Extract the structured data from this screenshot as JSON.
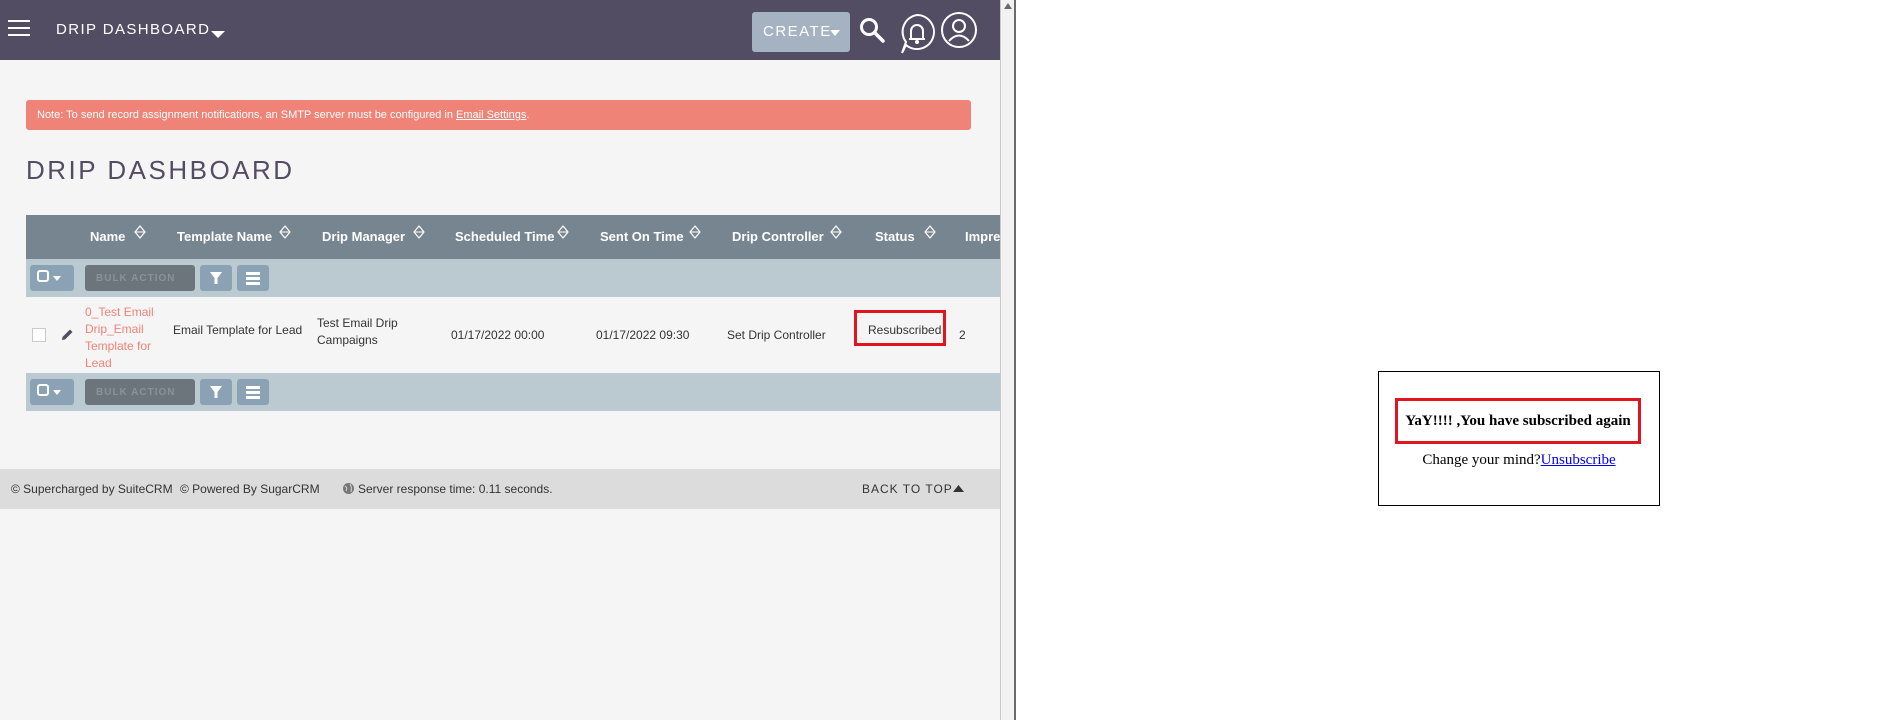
{
  "topbar": {
    "module_title": "DRIP DASHBOARD",
    "create_label": "CREATE"
  },
  "alert": {
    "text": "Note: To send record assignment notifications, an SMTP server must be configured in ",
    "link": "Email Settings",
    "suffix": "."
  },
  "page": {
    "title": "DRIP DASHBOARD"
  },
  "table": {
    "columns": [
      "Name",
      "Template Name",
      "Drip Manager",
      "Scheduled Time",
      "Sent On Time",
      "Drip Controller",
      "Status",
      "Impres"
    ],
    "bulk_action_label": "BULK ACTION",
    "rows": [
      {
        "name_lines": [
          "0_Test Email",
          "Drip_Email",
          "Template for",
          "Lead"
        ],
        "template_name": "Email Template for Lead",
        "drip_manager_lines": [
          "Test Email Drip",
          "Campaigns"
        ],
        "scheduled_time": "01/17/2022 00:00",
        "sent_on_time": "01/17/2022 09:30",
        "drip_controller": "Set Drip Controller",
        "status": "Resubscribed",
        "impressions": "2"
      }
    ]
  },
  "footer": {
    "supercharged": "© Supercharged by SuiteCRM",
    "powered": "© Powered By SugarCRM",
    "server_time": "Server response time: 0.11 seconds.",
    "back_to_top": "BACK TO TOP"
  },
  "subscription": {
    "message": "YaY!!!! ,You have subscribed again",
    "change_text": "Change your mind?",
    "unsubscribe_link": "Unsubscribe"
  },
  "colors": {
    "topbar": "#534d64",
    "alert": "#f08377",
    "table_header": "#778591",
    "action_bar": "#bbc9d0",
    "highlight_border": "#e0151f"
  }
}
